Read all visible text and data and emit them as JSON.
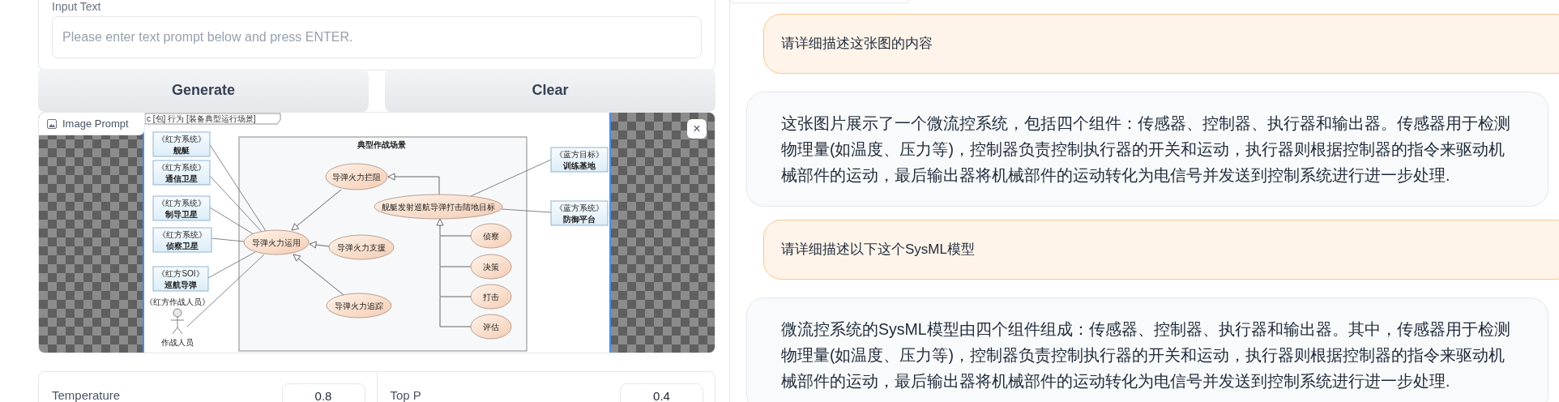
{
  "input_text": {
    "label": "Input Text",
    "placeholder": "Please enter text prompt below and press ENTER."
  },
  "buttons": [
    {
      "label": "Generate"
    },
    {
      "label": "Clear"
    }
  ],
  "image_prompt": {
    "label": "Image Prompt",
    "close": "×",
    "diagram": {
      "frame_label": "c [包] 行为 [装备典型运行场景]",
      "boundary_title": "典型作战场景",
      "blocks": [
        {
          "stereotype": "《红方系统》",
          "name": "舰艇"
        },
        {
          "stereotype": "《红方系统》",
          "name": "通信卫星"
        },
        {
          "stereotype": "《红方系统》",
          "name": "制导卫星"
        },
        {
          "stereotype": "《红方系统》",
          "name": "侦察卫星"
        },
        {
          "stereotype": "《红方SOI》",
          "name": "巡航导弹"
        },
        {
          "stereotype": "《蓝方目标》",
          "name": "训练基地"
        },
        {
          "stereotype": "《蓝方系统》",
          "name": "防御平台"
        }
      ],
      "actor": {
        "stereotype": "《红方作战人员》",
        "name": "作战人员"
      },
      "use_cases": [
        "导弹火力运用",
        "导弹火力拦阻",
        "导弹火力支援",
        "导弹火力追踪",
        "舰艇发射巡航导弹打击陆地目标",
        "侦察",
        "决策",
        "打击",
        "评估"
      ]
    }
  },
  "parameters": [
    {
      "label": "Temperature",
      "value": "0.8"
    },
    {
      "label": "Top P",
      "value": "0.4"
    }
  ],
  "chat": [
    {
      "kind": "user",
      "text": "请详细描述这张图的内容"
    },
    {
      "kind": "bot",
      "text": "这张图片展示了一个微流控系统，包括四个组件：传感器、控制器、执行器和输出器。传感器用于检测物理量(如温度、压力等)，控制器负责控制执行器的开关和运动，执行器则根据控制器的指令来驱动机械部件的运动，最后输出器将机械部件的运动转化为电信号并发送到控制系统进行进一步处理."
    },
    {
      "kind": "user",
      "text": "请详细描述以下这个SysML模型"
    },
    {
      "kind": "bot",
      "text": "微流控系统的SysML模型由四个组件组成：传感器、控制器、执行器和输出器。其中，传感器用于检测物理量(如温度、压力等)，控制器负责控制执行器的开关和运动，执行器则根据控制器的指令来驱动机械部件的运动，最后输出器将机械部件的运动转化为电信号并发送到控制系统进行进一步处理."
    }
  ]
}
